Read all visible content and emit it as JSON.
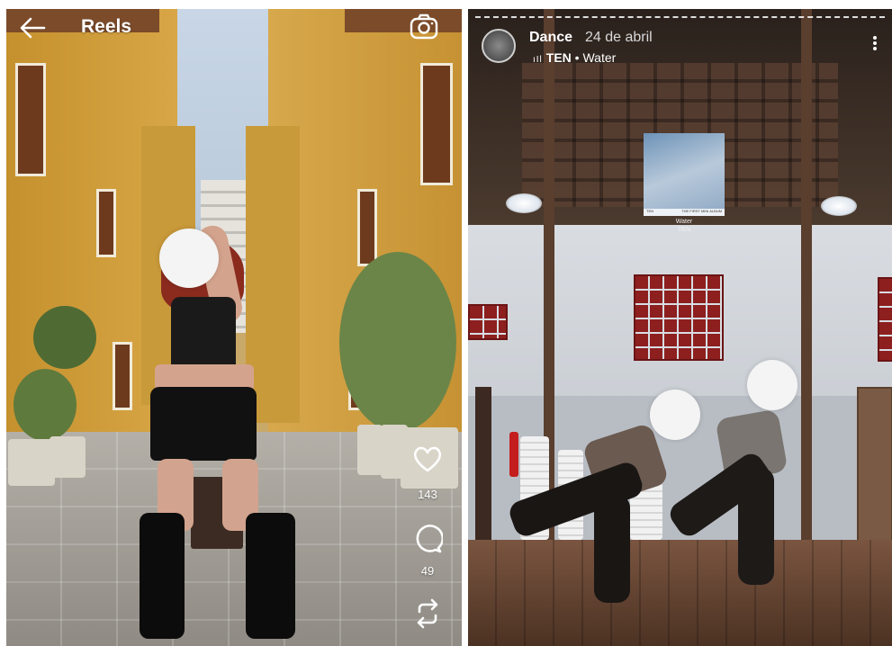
{
  "reels": {
    "title": "Reels",
    "likes": "143",
    "comments": "49",
    "icons": {
      "back": "arrow-left-icon",
      "camera": "camera-icon",
      "like": "heart-icon",
      "comment": "comment-bubble-icon",
      "share": "repost-icon"
    }
  },
  "story": {
    "username": "Dance",
    "date": "24 de abril",
    "music_bars": "ıIl",
    "music_artist": "TEN",
    "music_separator": "•",
    "music_song": "Water",
    "album_tag_left": "TEN",
    "album_tag_right": "THE FIRST MINI ALBUM",
    "album_song": "Water",
    "album_artist": "TEN",
    "icons": {
      "menu": "kebab-menu-icon"
    }
  }
}
